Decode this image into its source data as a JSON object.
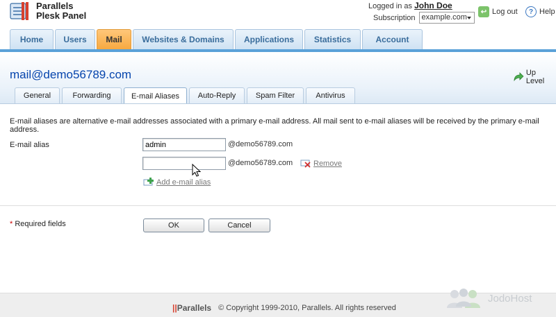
{
  "brand": {
    "line1": "Parallels",
    "line2": "Plesk Panel"
  },
  "user": {
    "logged_in_as": "Logged in as",
    "name": "John Doe",
    "subscription_label": "Subscription",
    "subscription_value": "example.com"
  },
  "header_links": {
    "logout": "Log out",
    "help": "Help"
  },
  "main_tabs": [
    "Home",
    "Users",
    "Mail",
    "Websites & Domains",
    "Applications",
    "Statistics",
    "Account"
  ],
  "page": {
    "title": "mail@demo56789.com",
    "up_level": "Up Level"
  },
  "sub_tabs": [
    "General",
    "Forwarding",
    "E-mail Aliases",
    "Auto-Reply",
    "Spam Filter",
    "Antivirus"
  ],
  "form": {
    "description": "E-mail aliases are alternative e-mail addresses associated with a primary e-mail address. All mail sent to e-mail aliases will be received by the primary e-mail address.",
    "alias_label": "E-mail alias",
    "alias1_value": "admin",
    "alias2_value": "",
    "domain_suffix": "@demo56789.com",
    "remove_label": "Remove",
    "add_label": "Add e-mail alias",
    "required_star": "*",
    "required_text": " Required fields",
    "ok_label": "OK",
    "cancel_label": "Cancel"
  },
  "footer": {
    "logo": "Parallels",
    "logo_bars": "||",
    "copyright": "© Copyright 1999-2010, Parallels. All rights reserved"
  },
  "watermark": "JodoHost",
  "colors": {
    "accent_blue": "#5aa1d8",
    "active_tab": "#f7a941",
    "title_link": "#0645ad"
  }
}
